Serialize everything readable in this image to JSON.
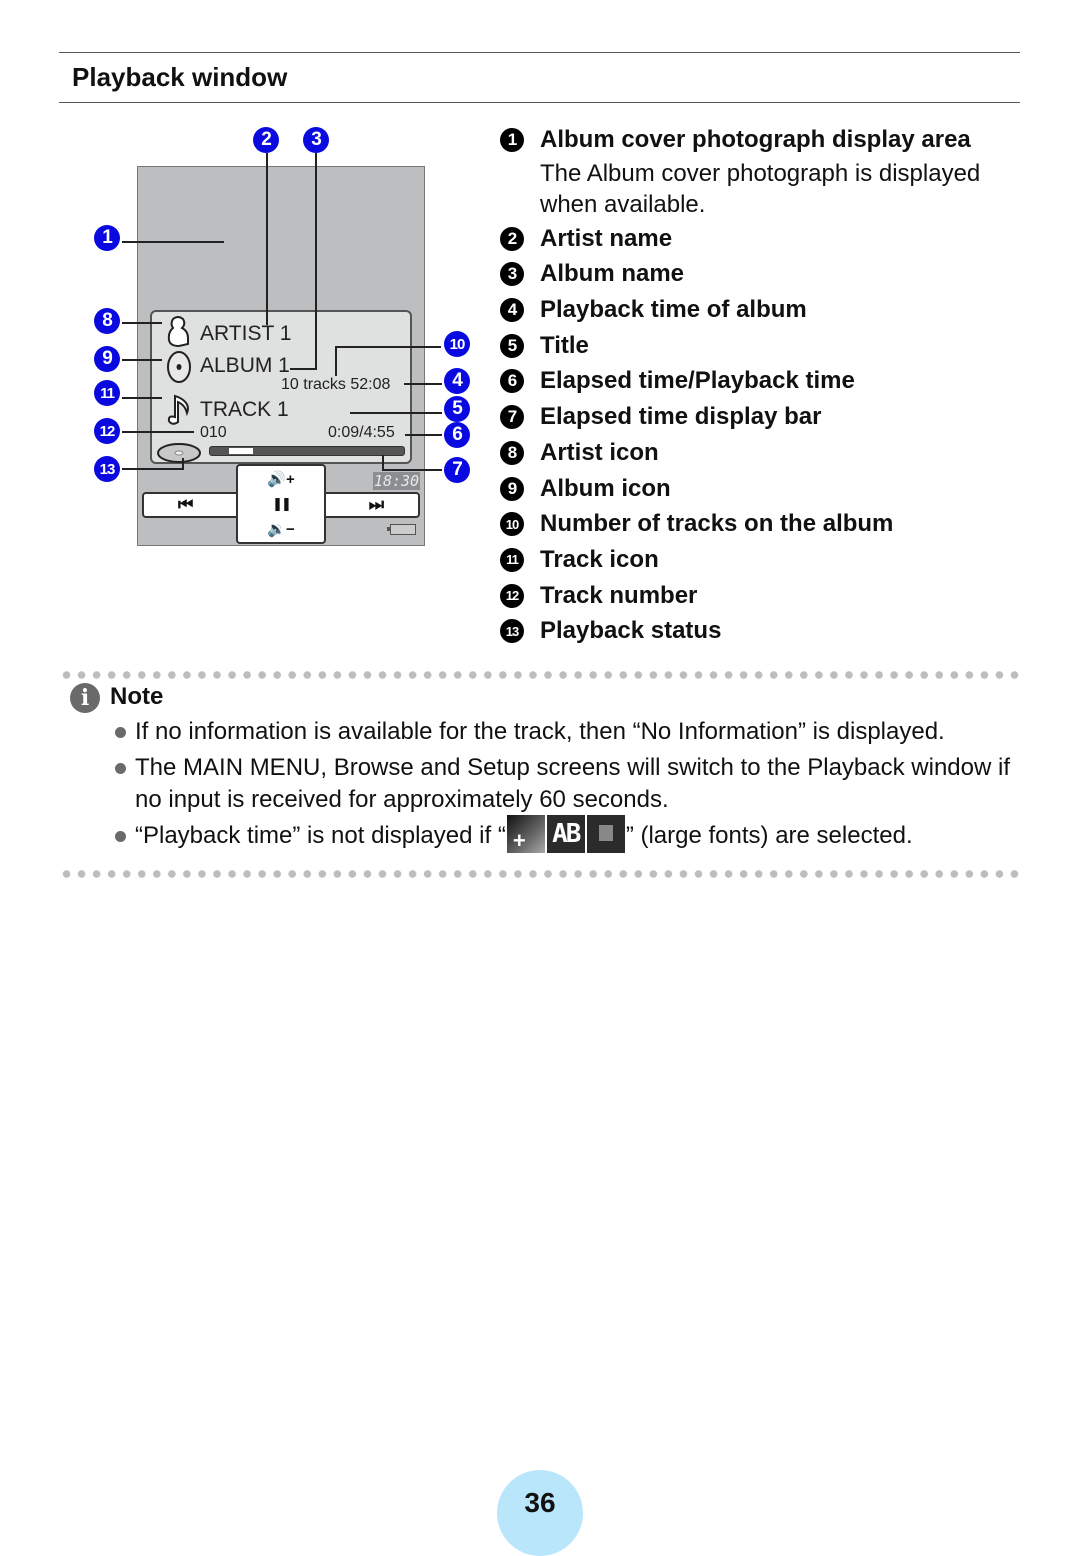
{
  "section": {
    "title": "Playback window"
  },
  "device": {
    "artist": "ARTIST 1",
    "album": "ALBUM 1",
    "album_info": "10 tracks 52:08",
    "track_title": "TRACK 1",
    "track_number": "010",
    "time": "0:09/4:55",
    "progress": {
      "elapsed_seconds": 9,
      "total_seconds": 295
    },
    "clock": "18:30",
    "controls": {
      "prev": "⏮",
      "pause": "❚❚",
      "next": "⏭",
      "vol_up": "🔊+",
      "vol_down": "🔉−"
    },
    "icons": [
      "artist-icon",
      "album-icon",
      "track-icon",
      "playback-status-icon",
      "battery-icon"
    ]
  },
  "callouts": [
    "1",
    "2",
    "3",
    "4",
    "5",
    "6",
    "7",
    "8",
    "9",
    "10",
    "11",
    "12",
    "13"
  ],
  "legend": [
    {
      "num": "1",
      "label": "Album cover photograph display area",
      "desc": "The Album cover photograph is displayed when available."
    },
    {
      "num": "2",
      "label": "Artist name"
    },
    {
      "num": "3",
      "label": "Album name"
    },
    {
      "num": "4",
      "label": "Playback time of album"
    },
    {
      "num": "5",
      "label": "Title"
    },
    {
      "num": "6",
      "label": "Elapsed time/Playback time"
    },
    {
      "num": "7",
      "label": "Elapsed time display bar"
    },
    {
      "num": "8",
      "label": "Artist icon"
    },
    {
      "num": "9",
      "label": "Album icon"
    },
    {
      "num": "10",
      "label": "Number of tracks on the album"
    },
    {
      "num": "11",
      "label": "Track icon"
    },
    {
      "num": "12",
      "label": "Track number"
    },
    {
      "num": "13",
      "label": "Playback status"
    }
  ],
  "note": {
    "title": "Note",
    "items": [
      "If no information is available for the track, then “No Information” is displayed.",
      "The MAIN MENU, Browse and Setup screens will switch to the Playback window if no input is received for approximately 60 seconds."
    ],
    "item3_before": "“Playback time” is not displayed if “",
    "item3_after": "” (large fonts) are selected.",
    "item3_icon_ab": "AB"
  },
  "page_number": "36",
  "colors": {
    "badge": "#0a0ae0",
    "page_circle": "#b9e6fb",
    "device_bg": "#bdbec0"
  }
}
